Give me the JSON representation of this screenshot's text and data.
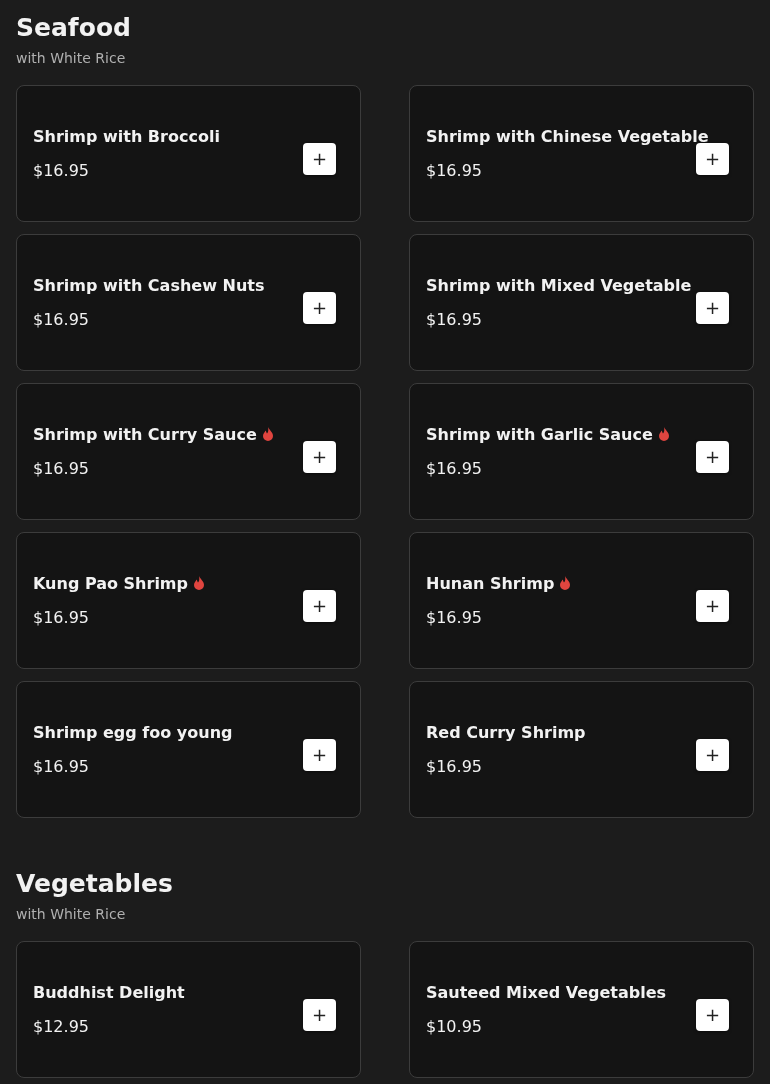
{
  "sections": [
    {
      "title": "Seafood",
      "subtitle": "with White Rice",
      "items": [
        {
          "name": "Shrimp with Broccoli",
          "price": "$16.95",
          "spicy": false,
          "button": "+"
        },
        {
          "name": "Shrimp with Chinese Vegetable",
          "price": "$16.95",
          "spicy": false,
          "button": "+"
        },
        {
          "name": "Shrimp with Cashew Nuts",
          "price": "$16.95",
          "spicy": false,
          "button": "+"
        },
        {
          "name": "Shrimp with Mixed Vegetable",
          "price": "$16.95",
          "spicy": false,
          "button": "+"
        },
        {
          "name": "Shrimp with Curry Sauce",
          "price": "$16.95",
          "spicy": true,
          "button": "+"
        },
        {
          "name": "Shrimp with Garlic Sauce",
          "price": "$16.95",
          "spicy": true,
          "button": "+"
        },
        {
          "name": "Kung Pao Shrimp",
          "price": "$16.95",
          "spicy": true,
          "button": "+"
        },
        {
          "name": "Hunan Shrimp",
          "price": "$16.95",
          "spicy": true,
          "button": "+"
        },
        {
          "name": "Shrimp egg foo young",
          "price": "$16.95",
          "spicy": false,
          "button": "+"
        },
        {
          "name": "Red Curry Shrimp",
          "price": "$16.95",
          "spicy": false,
          "button": "+"
        }
      ]
    },
    {
      "title": "Vegetables",
      "subtitle": "with White Rice",
      "items": [
        {
          "name": "Buddhist Delight",
          "price": "$12.95",
          "spicy": false,
          "button": "+"
        },
        {
          "name": "Sauteed Mixed Vegetables",
          "price": "$10.95",
          "spicy": false,
          "button": "+"
        }
      ]
    }
  ]
}
